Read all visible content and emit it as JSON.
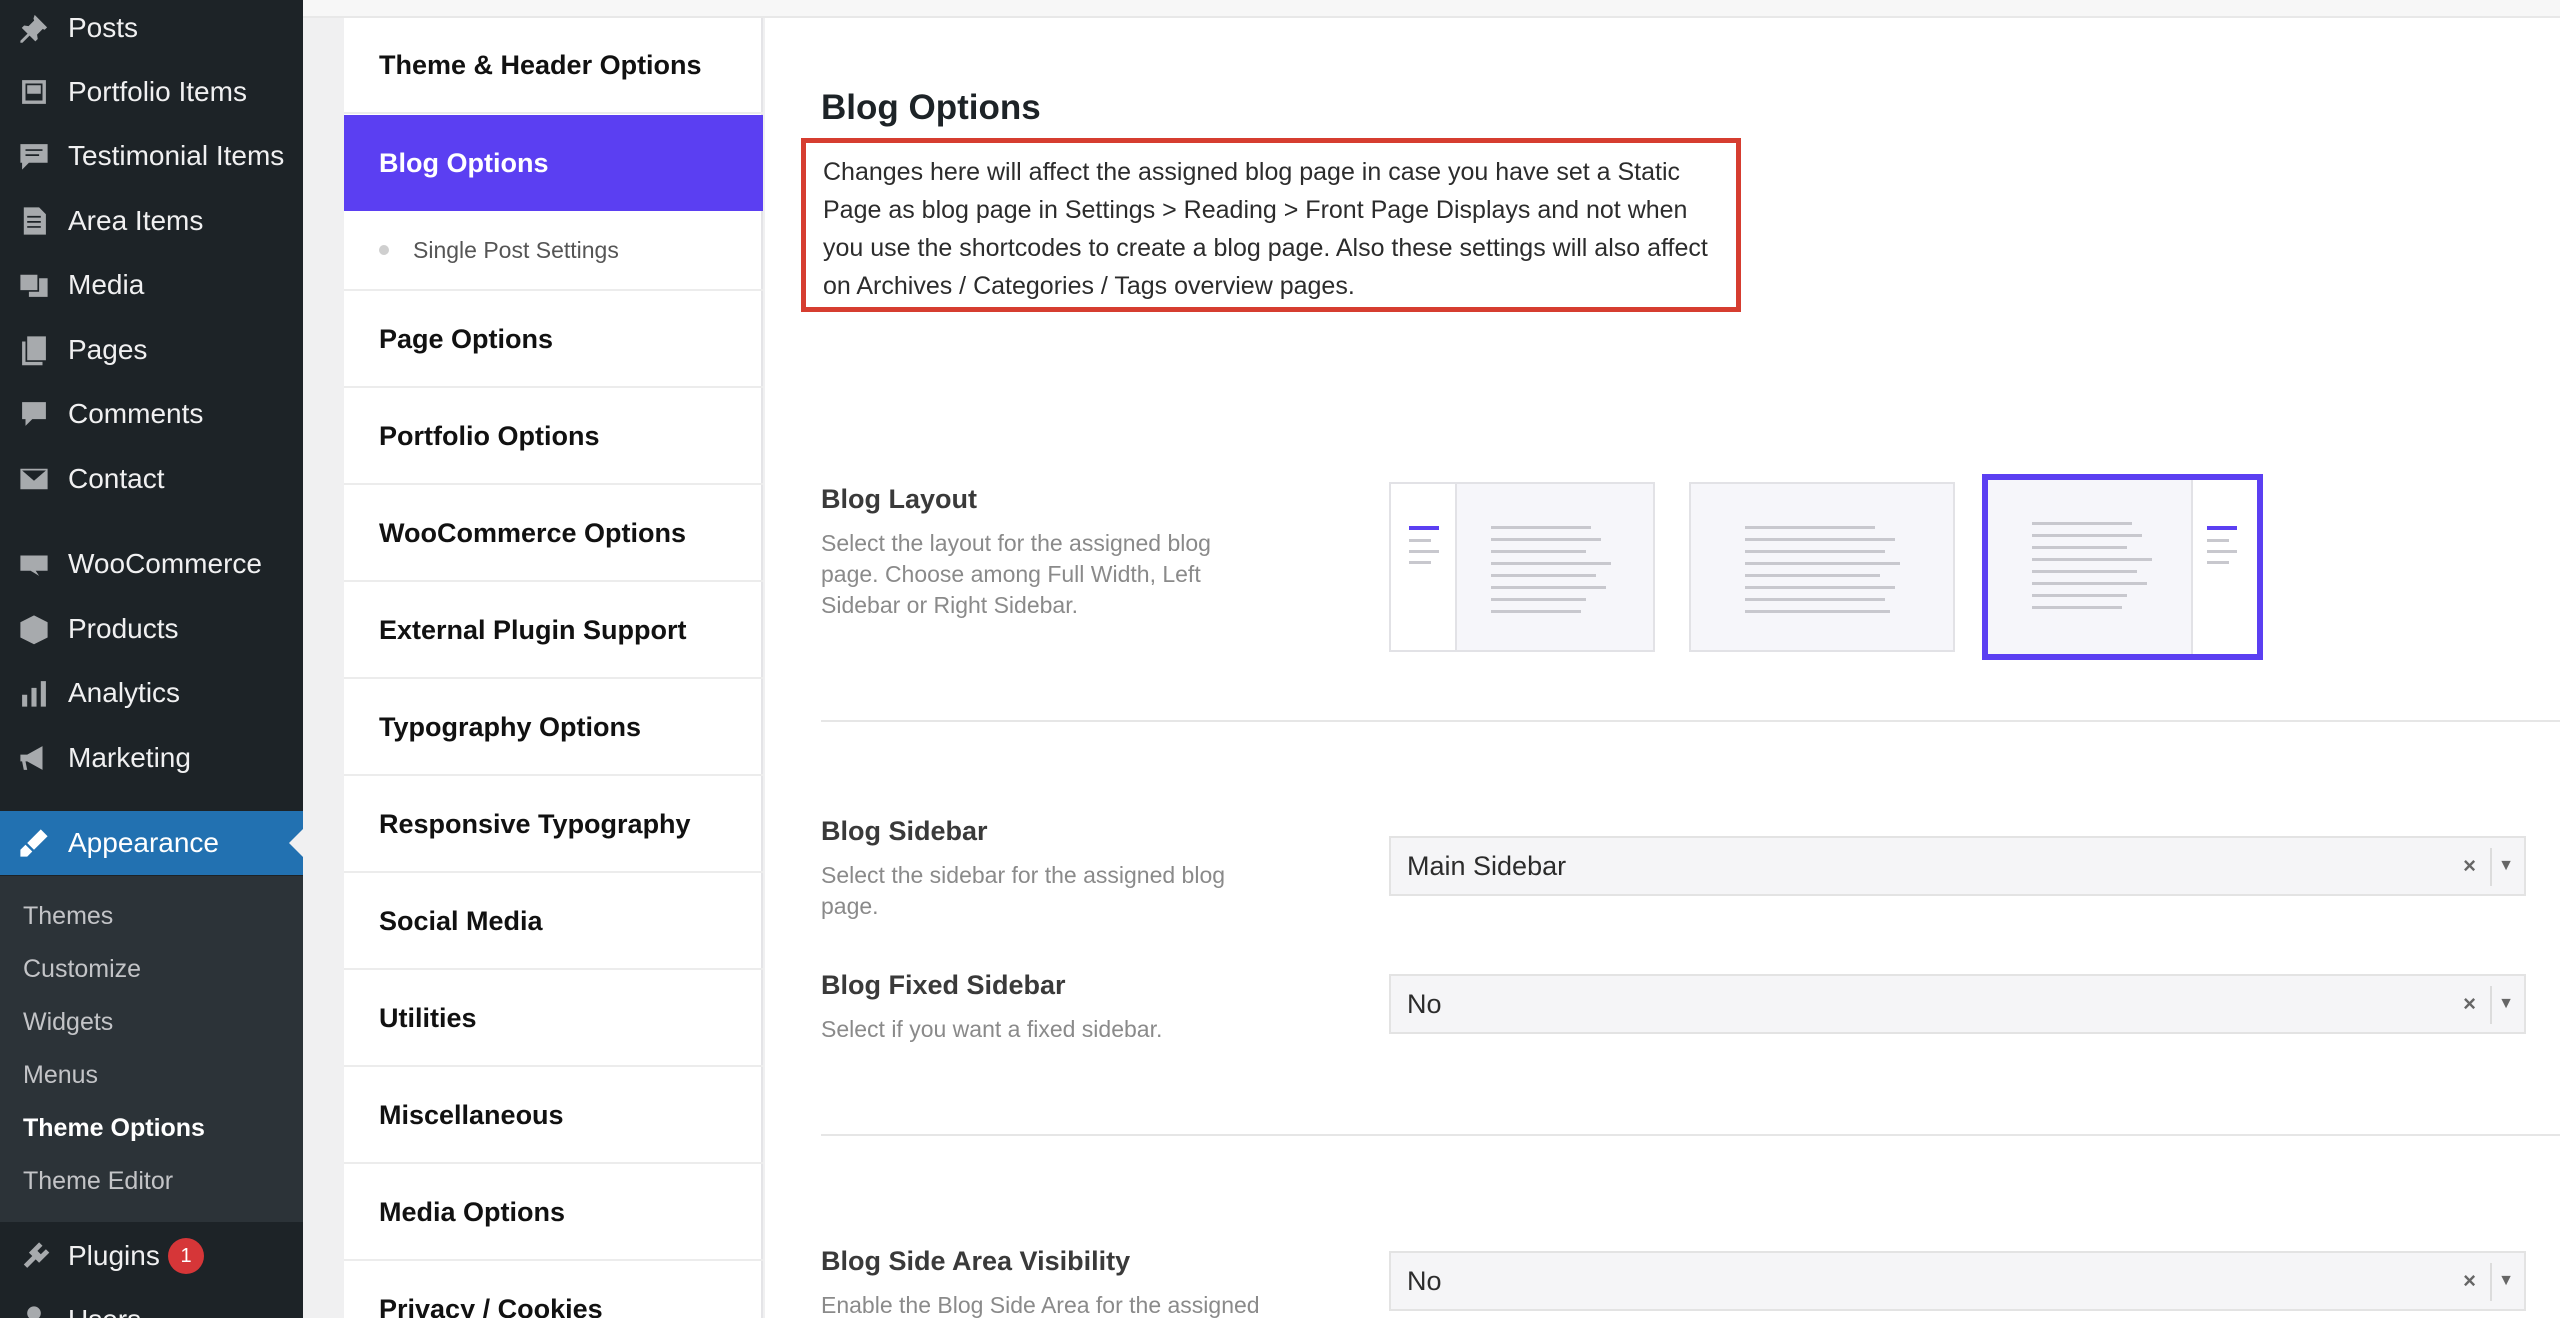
{
  "admin_menu": {
    "items": [
      {
        "label": "Posts",
        "icon": "pin-icon"
      },
      {
        "label": "Portfolio Items",
        "icon": "portfolio-icon"
      },
      {
        "label": "Testimonial Items",
        "icon": "testimonial-icon"
      },
      {
        "label": "Area Items",
        "icon": "area-icon"
      },
      {
        "label": "Media",
        "icon": "media-icon"
      },
      {
        "label": "Pages",
        "icon": "pages-icon"
      },
      {
        "label": "Comments",
        "icon": "comments-icon"
      },
      {
        "label": "Contact",
        "icon": "mail-icon"
      },
      {
        "label": "WooCommerce",
        "icon": "woo-icon"
      },
      {
        "label": "Products",
        "icon": "products-icon"
      },
      {
        "label": "Analytics",
        "icon": "analytics-icon"
      },
      {
        "label": "Marketing",
        "icon": "megaphone-icon"
      },
      {
        "label": "Appearance",
        "icon": "brush-icon",
        "current": true
      },
      {
        "label": "Plugins",
        "icon": "plugin-icon",
        "badge": "1"
      },
      {
        "label": "Users",
        "icon": "users-icon"
      }
    ],
    "appearance_submenu": [
      "Themes",
      "Customize",
      "Widgets",
      "Menus",
      "Theme Options",
      "Theme Editor"
    ],
    "current_submenu": "Theme Options"
  },
  "options_nav": {
    "items": [
      "Theme & Header Options",
      "Blog Options",
      "Page Options",
      "Portfolio Options",
      "WooCommerce Options",
      "External Plugin Support",
      "Typography Options",
      "Responsive Typography",
      "Social Media",
      "Utilities",
      "Miscellaneous",
      "Media Options",
      "Privacy / Cookies"
    ],
    "active": "Blog Options",
    "sub_items": [
      "Single Post Settings"
    ]
  },
  "main": {
    "section_title": "Blog Options",
    "notice": "Changes here will affect the assigned blog page in case you have set a Static Page as blog page in Settings > Reading > Front Page Displays and not when you use the shortcodes to create a blog page. Also these settings will also affect on Archives / Categories / Tags overview pages.",
    "blog_layout": {
      "title": "Blog Layout",
      "desc": "Select the layout for the assigned blog page. Choose among Full Width, Left Sidebar or Right Sidebar.",
      "options": [
        "left-sidebar",
        "full-width",
        "right-sidebar"
      ],
      "selected": "right-sidebar"
    },
    "blog_sidebar": {
      "title": "Blog Sidebar",
      "desc": "Select the sidebar for the assigned blog page.",
      "value": "Main Sidebar"
    },
    "blog_fixed_sidebar": {
      "title": "Blog Fixed Sidebar",
      "desc": "Select if you want a fixed sidebar.",
      "value": "No"
    },
    "blog_side_area": {
      "title": "Blog Side Area Visibility",
      "desc": "Enable the Blog Side Area for the assigned blog page.",
      "value": "No"
    }
  },
  "colors": {
    "accent": "#5b3ff2",
    "wp_menu_bg": "#1d2327",
    "wp_current": "#2271b1",
    "notice_border": "#d63d30"
  }
}
